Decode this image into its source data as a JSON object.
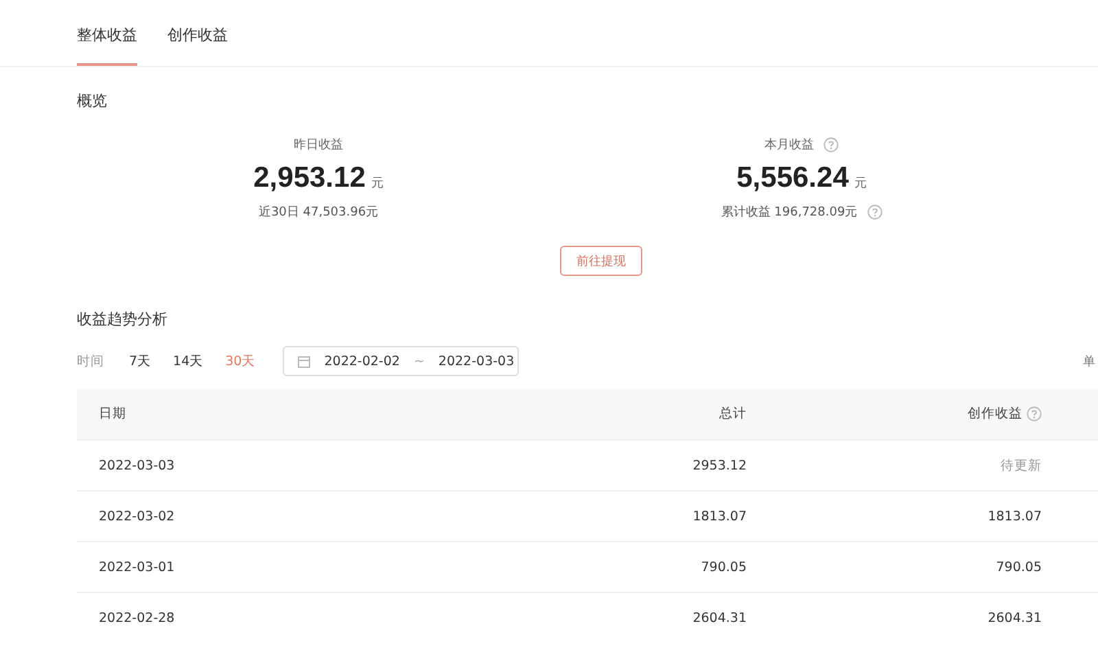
{
  "tabs": [
    {
      "label": "整体收益",
      "selected": true
    },
    {
      "label": "创作收益",
      "selected": false
    }
  ],
  "overview": {
    "title": "概览",
    "stats": [
      {
        "label": "昨日收益",
        "help": false,
        "value": "2,953.12",
        "unit": "元",
        "sub": "近30日 47,503.96元",
        "sub_help": false
      },
      {
        "label": "本月收益",
        "help": true,
        "value": "5,556.24",
        "unit": "元",
        "sub": "累计收益 196,728.09元",
        "sub_help": true
      }
    ],
    "button": "前往提现"
  },
  "trend": {
    "title": "收益趋势分析",
    "filter_label": "时间",
    "ranges": [
      {
        "label": "7天",
        "selected": false
      },
      {
        "label": "14天",
        "selected": false
      },
      {
        "label": "30天",
        "selected": true
      }
    ],
    "date_start": "2022-02-02",
    "date_sep": "~",
    "date_end": "2022-03-03",
    "unit_label": "单"
  },
  "table": {
    "columns": [
      {
        "label": "日期",
        "help": false
      },
      {
        "label": "总计",
        "help": false
      },
      {
        "label": "创作收益",
        "help": true
      }
    ],
    "rows": [
      {
        "date": "2022-03-03",
        "total": "2953.12",
        "creation": "待更新",
        "pending": true
      },
      {
        "date": "2022-03-02",
        "total": "1813.07",
        "creation": "1813.07",
        "pending": false
      },
      {
        "date": "2022-03-01",
        "total": "790.05",
        "creation": "790.05",
        "pending": false
      },
      {
        "date": "2022-02-28",
        "total": "2604.31",
        "creation": "2604.31",
        "pending": false
      }
    ]
  }
}
